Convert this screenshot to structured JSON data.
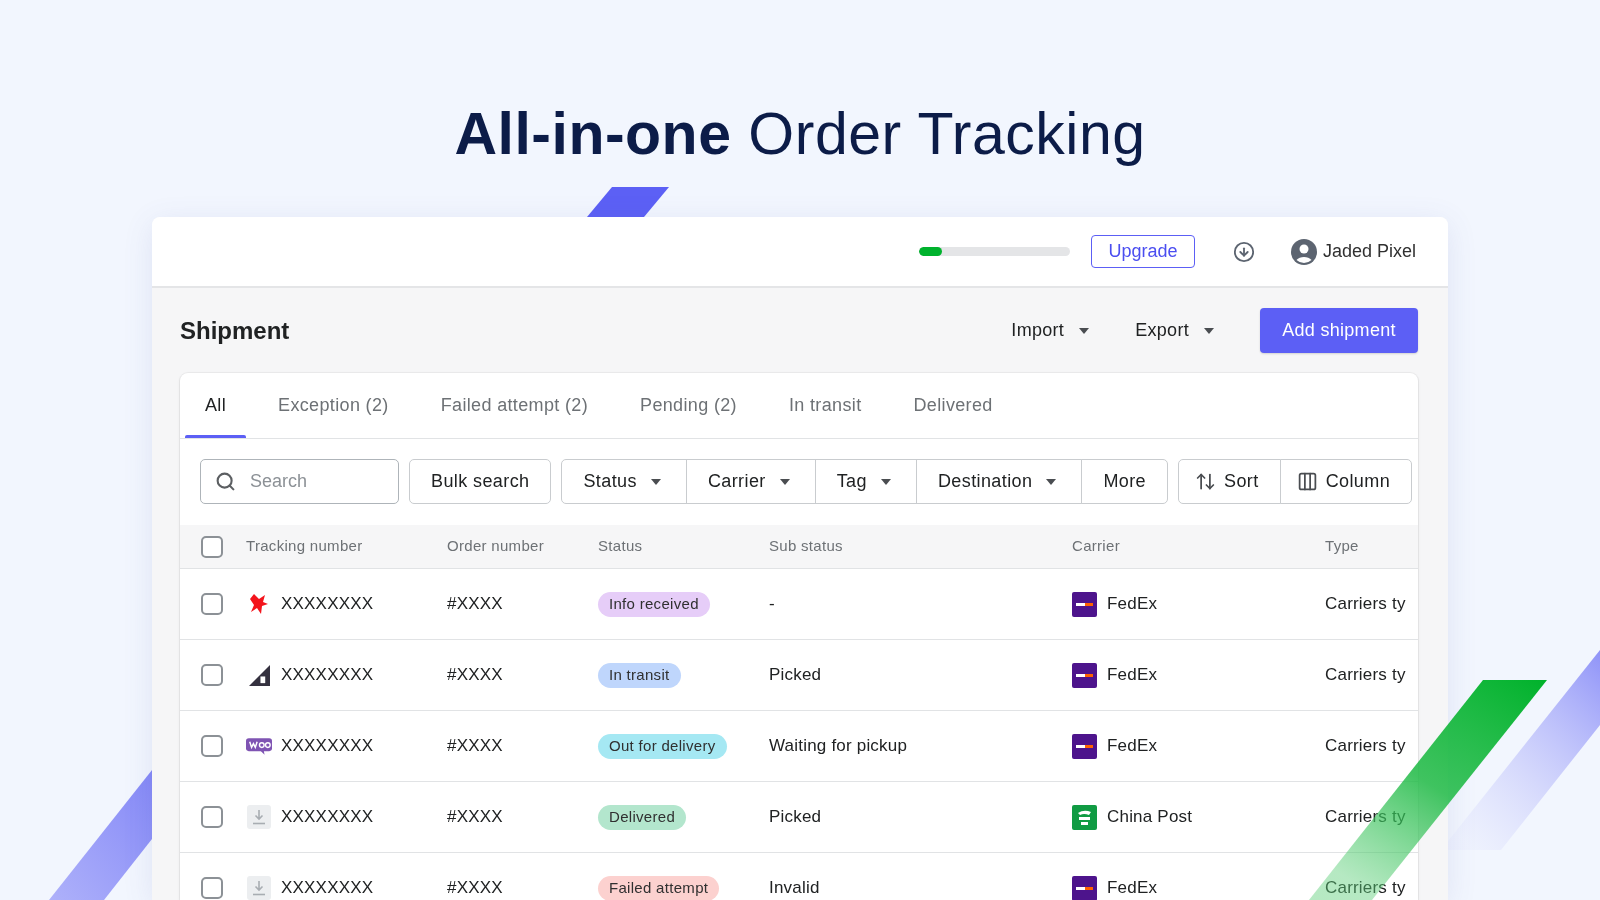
{
  "headline": "**All-in-one** Order Tracking",
  "top_bar": {
    "usage": {
      "level": 0.15
    },
    "upgrade": "Upgrade",
    "user": {
      "name": "Jaded Pixel"
    }
  },
  "page": {
    "title": "Shipment",
    "actions": [
      {
        "label": "Import",
        "kind": "dropdown"
      },
      {
        "label": "Export",
        "kind": "dropdown"
      },
      {
        "label": "Add shipment",
        "kind": "primary"
      }
    ]
  },
  "tabs": [
    {
      "label": "All",
      "selected": true
    },
    {
      "label": "Exception (2)",
      "selected": false
    },
    {
      "label": "Failed attempt (2)",
      "selected": false
    },
    {
      "label": "Pending (2)",
      "selected": false
    },
    {
      "label": "In transit",
      "selected": false
    },
    {
      "label": "Delivered",
      "selected": false
    }
  ],
  "toolbar": {
    "search": {
      "placeholder": "Search"
    },
    "button_groups": [
      {
        "buttons": [
          {
            "label": "Bulk search",
            "kind": "plain"
          }
        ]
      },
      {
        "buttons": [
          {
            "label": "Status",
            "kind": "dropdown"
          },
          {
            "label": "Carrier",
            "kind": "dropdown"
          },
          {
            "label": "Tag",
            "kind": "dropdown"
          },
          {
            "label": "Destination",
            "kind": "dropdown"
          },
          {
            "label": "More",
            "kind": "plain"
          }
        ]
      },
      {
        "buttons": [
          {
            "label": "Sort",
            "kind": "sort"
          },
          {
            "label": "Column",
            "kind": "columns"
          }
        ]
      }
    ]
  },
  "table": {
    "select_all": {
      "checked": false
    },
    "columns": [
      "Tracking number",
      "Order number",
      "Status",
      "Sub status",
      "Carrier",
      "Type"
    ],
    "rows": [
      {
        "checked": false,
        "source": {
          "kind": "splash"
        },
        "tracking_number": "XXXXXXXX",
        "order_number": "#XXXX",
        "status": {
          "label": "Info received",
          "color": "#e6cdf8"
        },
        "sub_status": "-",
        "carrier": {
          "kind": "square",
          "name": "FedEx"
        },
        "type": "Carriers ty"
      },
      {
        "checked": false,
        "source": {
          "kind": "triangle"
        },
        "tracking_number": "XXXXXXXX",
        "order_number": "#XXXX",
        "status": {
          "label": "In transit",
          "color": "#bfd6fc"
        },
        "sub_status": "Picked",
        "carrier": {
          "kind": "square",
          "name": "FedEx"
        },
        "type": "Carriers ty"
      },
      {
        "checked": false,
        "source": {
          "kind": "bubble"
        },
        "tracking_number": "XXXXXXXX",
        "order_number": "#XXXX",
        "status": {
          "label": "Out for delivery",
          "color": "#a5e8f3"
        },
        "sub_status": "Waiting for pickup",
        "carrier": {
          "kind": "square",
          "name": "FedEx"
        },
        "type": "Carriers ty"
      },
      {
        "checked": false,
        "source": {
          "kind": "download"
        },
        "tracking_number": "XXXXXXXX",
        "order_number": "#XXXX",
        "status": {
          "label": "Delivered",
          "color": "#b3e6cd"
        },
        "sub_status": "Picked",
        "carrier": {
          "kind": "stamp",
          "name": "China Post"
        },
        "type": "Carriers ty"
      },
      {
        "checked": false,
        "source": {
          "kind": "download"
        },
        "tracking_number": "XXXXXXXX",
        "order_number": "#XXXX",
        "status": {
          "label": "Failed attempt",
          "color": "#fcd1cf"
        },
        "sub_status": "Invalid",
        "carrier": {
          "kind": "square",
          "name": "FedEx"
        },
        "type": "Carriers ty"
      }
    ]
  }
}
